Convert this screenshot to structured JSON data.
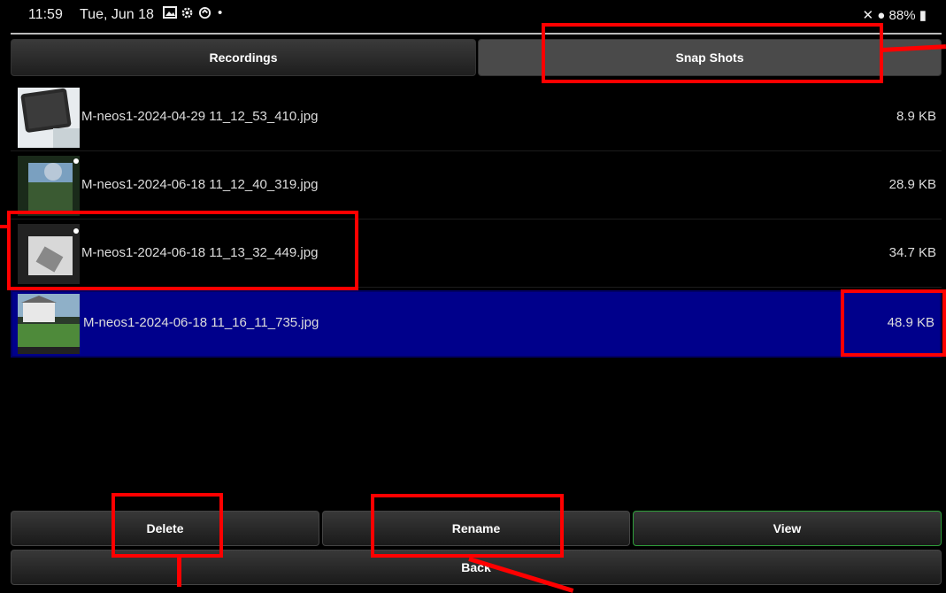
{
  "status_bar": {
    "time": "11:59",
    "date": "Tue, Jun 18",
    "icons_left": [
      "gallery-icon",
      "settings-icon",
      "sync-icon",
      "dot"
    ],
    "battery": "88%"
  },
  "tabs": [
    {
      "label": "Recordings",
      "active": false
    },
    {
      "label": "Snap Shots",
      "active": true
    }
  ],
  "files": [
    {
      "name": "M-neos1-2024-04-29 11_12_53_410.jpg",
      "size": "8.9 KB",
      "selected": false
    },
    {
      "name": "M-neos1-2024-06-18 11_12_40_319.jpg",
      "size": "28.9 KB",
      "selected": false
    },
    {
      "name": "M-neos1-2024-06-18 11_13_32_449.jpg",
      "size": "34.7 KB",
      "selected": false
    },
    {
      "name": "M-neos1-2024-06-18 11_16_11_735.jpg",
      "size": "48.9 KB",
      "selected": true
    }
  ],
  "actions": {
    "delete": "Delete",
    "rename": "Rename",
    "view": "View",
    "back": "Back"
  },
  "colors": {
    "selected_row": "#00008b",
    "highlight": "#ff0000",
    "view_border": "#2e9e3a"
  }
}
